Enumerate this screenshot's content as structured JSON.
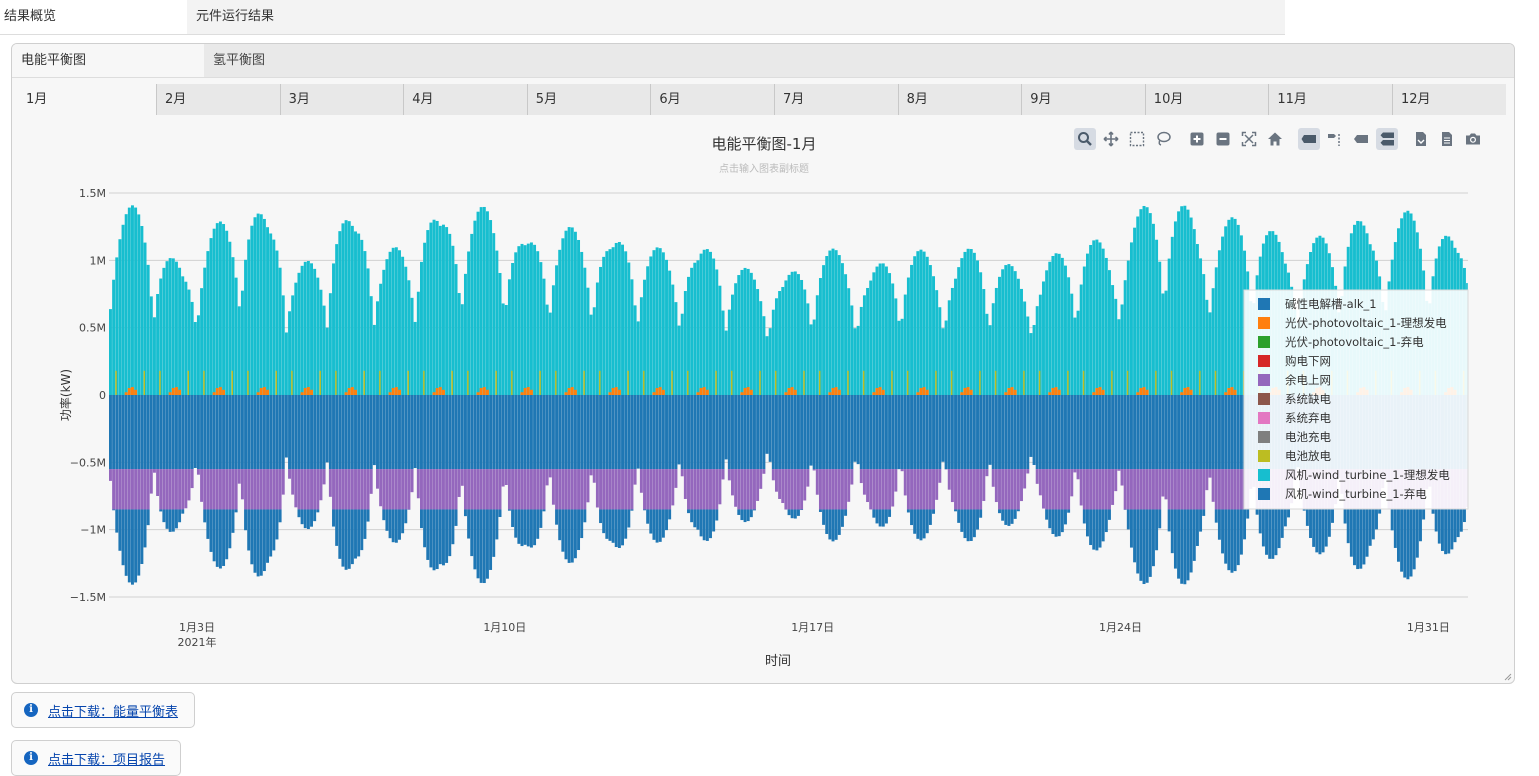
{
  "top_tabs": [
    {
      "label": "结果概览",
      "active": true
    },
    {
      "label": "元件运行结果",
      "active": false
    }
  ],
  "sub_tabs": [
    {
      "label": "电能平衡图",
      "active": true
    },
    {
      "label": "氢平衡图",
      "active": false
    }
  ],
  "months": [
    "1月",
    "2月",
    "3月",
    "4月",
    "5月",
    "6月",
    "7月",
    "8月",
    "9月",
    "10月",
    "11月",
    "12月"
  ],
  "active_month": "1月",
  "modebar_icons": [
    "zoom-icon",
    "pan-icon",
    "box-select-icon",
    "lasso-select-icon",
    "zoom-in-icon",
    "zoom-out-icon",
    "autoscale-icon",
    "reset-axes-icon",
    "spike-lines-icon",
    "toggle-spike-icon",
    "hover-closest-icon",
    "hover-compare-icon",
    "download-csv-icon",
    "download-data-icon",
    "camera-icon"
  ],
  "chart_data": {
    "type": "bar",
    "title": "电能平衡图-1月",
    "subtitle": "点击输入图表副标题",
    "xlabel": "时间",
    "ylabel": "功率(kW)",
    "ylim": [
      -1500000,
      1500000
    ],
    "yticks": [
      {
        "value": 1500000,
        "label": "1.5M"
      },
      {
        "value": 1000000,
        "label": "1M"
      },
      {
        "value": 500000,
        "label": "0.5M"
      },
      {
        "value": 0,
        "label": "0"
      },
      {
        "value": -500000,
        "label": "−0.5M"
      },
      {
        "value": -1000000,
        "label": "−1M"
      },
      {
        "value": -1500000,
        "label": "−1.5M"
      }
    ],
    "xrange_days": [
      1,
      31.9
    ],
    "xticks": [
      {
        "day": 3,
        "label": "1月3日",
        "sublabel": "2021年"
      },
      {
        "day": 10,
        "label": "1月10日",
        "sublabel": ""
      },
      {
        "day": 17,
        "label": "1月17日",
        "sublabel": ""
      },
      {
        "day": 24,
        "label": "1月24日",
        "sublabel": ""
      },
      {
        "day": 31,
        "label": "1月31日",
        "sublabel": ""
      }
    ],
    "stacked": true,
    "legend_position": "right",
    "series": [
      {
        "name": "碱性电解槽-alk_1",
        "color": "#1f77b4"
      },
      {
        "name": "光伏-photovoltaic_1-理想发电",
        "color": "#ff7f0e"
      },
      {
        "name": "光伏-photovoltaic_1-弃电",
        "color": "#2ca02c"
      },
      {
        "name": "购电下网",
        "color": "#d62728"
      },
      {
        "name": "余电上网",
        "color": "#9467bd"
      },
      {
        "name": "系统缺电",
        "color": "#8c564b"
      },
      {
        "name": "系统弃电",
        "color": "#e377c2"
      },
      {
        "name": "电池充电",
        "color": "#7f7f7f"
      },
      {
        "name": "电池放电",
        "color": "#bcbd22"
      },
      {
        "name": "风机-wind_turbine_1-理想发电",
        "color": "#17becf"
      },
      {
        "name": "风机-wind_turbine_1-弃电",
        "color": "#1f77b4"
      }
    ],
    "daily_peak_wind_kw": [
      1430000,
      1100000,
      1300000,
      1480000,
      1000000,
      1450000,
      1100000,
      1480000,
      1400000,
      1300000,
      1250000,
      1280000,
      1100000,
      1200000,
      950000,
      1000000,
      1100000,
      1050000,
      1100000,
      1150000,
      1000000,
      1100000,
      1200000,
      1450000,
      1480000,
      1350000,
      1300000,
      1200000,
      1400000,
      1380000,
      1300000
    ],
    "daily_pv_peak_kw": 60000,
    "electrolyzer_min_kw": -550000,
    "grid_export_min_kw": -850000
  },
  "downloads": [
    {
      "label": "点击下载：能量平衡表"
    },
    {
      "label": "点击下载：项目报告"
    }
  ]
}
